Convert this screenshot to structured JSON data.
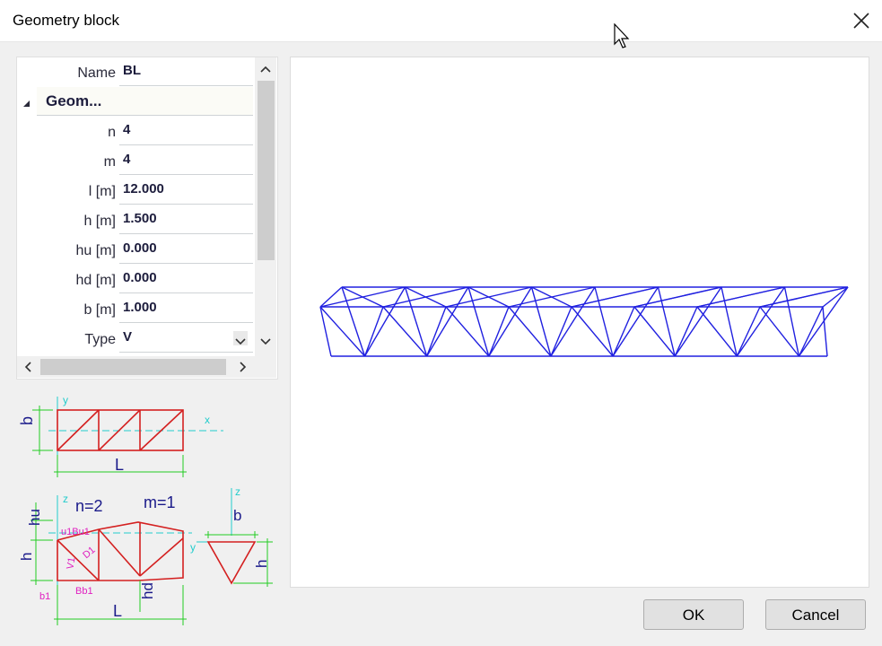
{
  "window": {
    "title": "Geometry block"
  },
  "properties": [
    {
      "label": "Name",
      "value": "BL"
    },
    {
      "group": "Geom..."
    },
    {
      "label": "n",
      "value": "4"
    },
    {
      "label": "m",
      "value": "4"
    },
    {
      "label": "l [m]",
      "value": "12.000"
    },
    {
      "label": "h [m]",
      "value": "1.500"
    },
    {
      "label": "hu [m]",
      "value": "0.000"
    },
    {
      "label": "hd [m]",
      "value": "0.000"
    },
    {
      "label": "b [m]",
      "value": "1.000"
    },
    {
      "label": "Type",
      "value": "V"
    }
  ],
  "diagram": {
    "plan": {
      "b": "b",
      "L": "L",
      "y": "y",
      "x": "x"
    },
    "elevation": {
      "n": "n=2",
      "m": "m=1",
      "hu": "hu",
      "h": "h",
      "hd": "hd",
      "L": "L",
      "z": "z",
      "b1": "b1",
      "ulbul": "u1Bu1",
      "d1": "D1",
      "v1": "V1",
      "bb1": "Bb1"
    },
    "section": {
      "z": "z",
      "b": "b",
      "h": "h",
      "y": "y"
    }
  },
  "buttons": {
    "ok": "OK",
    "cancel": "Cancel"
  },
  "colors": {
    "truss": "#2020e0",
    "diagram_red": "#d42020",
    "dim_green": "#22cc22",
    "axis_cyan": "#22cccc",
    "label_magenta": "#e020c0"
  }
}
